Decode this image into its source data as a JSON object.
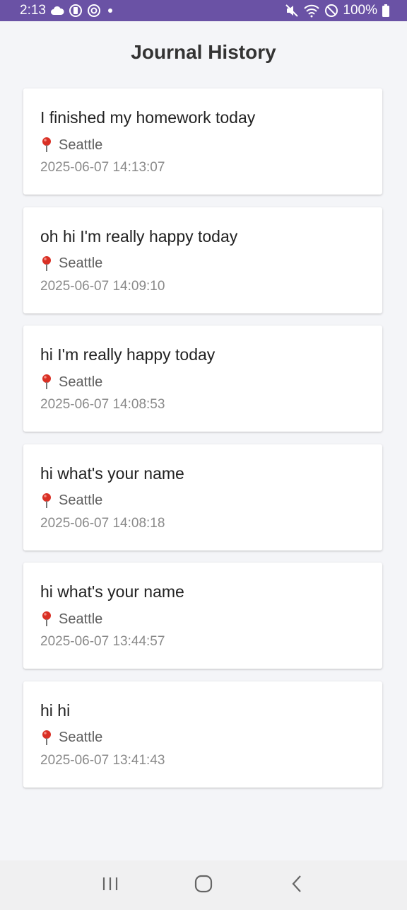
{
  "status_bar": {
    "time": "2:13",
    "battery": "100%",
    "left_icons": [
      "cloud-icon",
      "device-icon",
      "sync-icon"
    ],
    "right_icons": [
      "mute-icon",
      "wifi-icon",
      "do-not-disturb-icon",
      "battery-icon"
    ]
  },
  "page": {
    "title": "Journal History"
  },
  "entries": [
    {
      "text": "I finished my homework today",
      "location": "Seattle",
      "timestamp": "2025-06-07 14:13:07"
    },
    {
      "text": "oh hi I'm really happy today",
      "location": "Seattle",
      "timestamp": "2025-06-07 14:09:10"
    },
    {
      "text": "hi I'm really happy today",
      "location": "Seattle",
      "timestamp": "2025-06-07 14:08:53"
    },
    {
      "text": "hi what's your name",
      "location": "Seattle",
      "timestamp": "2025-06-07 14:08:18"
    },
    {
      "text": "hi what's your name",
      "location": "Seattle",
      "timestamp": "2025-06-07 13:44:57"
    },
    {
      "text": "hi hi",
      "location": "Seattle",
      "timestamp": "2025-06-07 13:41:43"
    }
  ],
  "nav_bar": {
    "icons": [
      "recents-icon",
      "home-icon",
      "back-icon"
    ]
  },
  "colors": {
    "status_bar": "#6a52a5",
    "background": "#f4f5f8",
    "pin": "#d93025"
  }
}
